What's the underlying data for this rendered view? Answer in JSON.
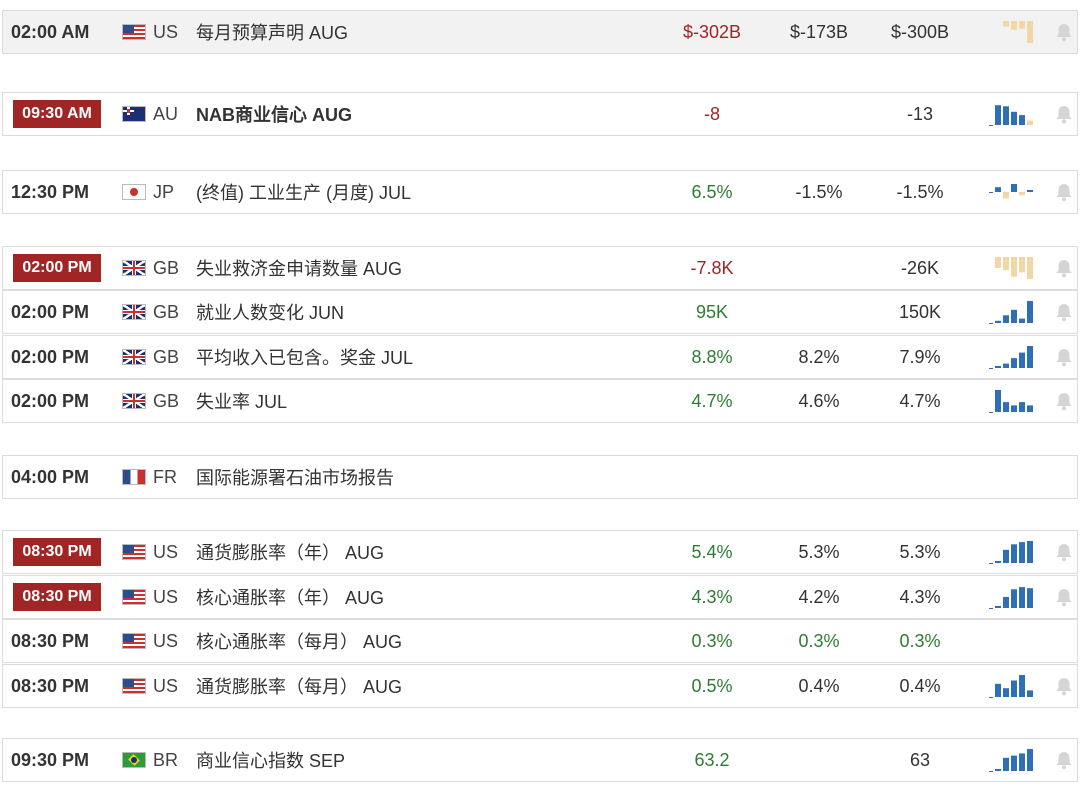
{
  "colors": {
    "highlight_time_bg": "#a12525",
    "negative": "#a12525",
    "positive": "#2e7d32",
    "spark_blue": "#2f6fb5",
    "spark_tan": "#f3d6a6",
    "bell": "#d5d5d5"
  },
  "events": [
    {
      "time": "02:00 AM",
      "highlight": false,
      "shaded": true,
      "flag": "us",
      "country": "US",
      "event": "每月预算声明 AUG",
      "bold": false,
      "actual": "$-302B",
      "actual_tone": "neg",
      "forecast": "$-173B",
      "previous": "$-300B",
      "previous_tone": "",
      "spark": "tan",
      "spark_values": [
        0.25,
        0.4,
        0.35,
        1.0
      ],
      "bell": true
    },
    {
      "time": "09:30 AM",
      "highlight": true,
      "shaded": false,
      "flag": "au",
      "country": "AU",
      "event": "NAB商业信心 AUG",
      "bold": true,
      "actual": "-8",
      "actual_tone": "neg",
      "forecast": "",
      "previous": "-13",
      "previous_tone": "",
      "spark": "blue",
      "spark_values": [
        0.9,
        0.85,
        0.6,
        0.45,
        0.2
      ],
      "bell": true
    },
    {
      "time": "12:30 PM",
      "highlight": false,
      "shaded": false,
      "flag": "jp",
      "country": "JP",
      "event": "(终值) 工业生产 (月度) JUL",
      "bold": false,
      "actual": "6.5%",
      "actual_tone": "pos",
      "forecast": "-1.5%",
      "previous": "-1.5%",
      "previous_tone": "",
      "spark": "mixed",
      "spark_values": [
        0.3,
        -0.4,
        0.5,
        -0.2,
        0.1
      ],
      "bell": true
    },
    {
      "time": "02:00 PM",
      "highlight": true,
      "shaded": false,
      "flag": "gb",
      "country": "GB",
      "event": "失业救济金申请数量 AUG",
      "bold": false,
      "actual": "-7.8K",
      "actual_tone": "neg",
      "forecast": "",
      "previous": "-26K",
      "previous_tone": "",
      "spark": "tan",
      "spark_values": [
        0.5,
        0.6,
        0.9,
        0.7,
        1.0
      ],
      "bell": true
    },
    {
      "time": "02:00 PM",
      "highlight": false,
      "shaded": false,
      "flag": "gb",
      "country": "GB",
      "event": "就业人数变化 JUN",
      "bold": false,
      "actual": "95K",
      "actual_tone": "pos",
      "forecast": "",
      "previous": "150K",
      "previous_tone": "",
      "spark": "blue",
      "spark_values": [
        0.1,
        0.35,
        0.6,
        0.2,
        1.0
      ],
      "bell": true
    },
    {
      "time": "02:00 PM",
      "highlight": false,
      "shaded": false,
      "flag": "gb",
      "country": "GB",
      "event": "平均收入已包含。奖金 JUL",
      "bold": false,
      "actual": "8.8%",
      "actual_tone": "pos",
      "forecast": "8.2%",
      "previous": "7.9%",
      "previous_tone": "",
      "spark": "blue",
      "spark_values": [
        0.05,
        0.2,
        0.45,
        0.7,
        1.0
      ],
      "bell": true
    },
    {
      "time": "02:00 PM",
      "highlight": false,
      "shaded": false,
      "flag": "gb",
      "country": "GB",
      "event": "失业率 JUL",
      "bold": false,
      "actual": "4.7%",
      "actual_tone": "pos",
      "forecast": "4.6%",
      "previous": "4.7%",
      "previous_tone": "",
      "spark": "blue",
      "spark_values": [
        1.0,
        0.45,
        0.3,
        0.45,
        0.3
      ],
      "bell": true
    },
    {
      "time": "04:00 PM",
      "highlight": false,
      "shaded": false,
      "flag": "fr",
      "country": "FR",
      "event": "国际能源署石油市场报告",
      "bold": false,
      "actual": "",
      "actual_tone": "",
      "forecast": "",
      "previous": "",
      "previous_tone": "",
      "spark": "none",
      "spark_values": [],
      "bell": false
    },
    {
      "time": "08:30 PM",
      "highlight": true,
      "shaded": false,
      "flag": "us",
      "country": "US",
      "event": "通货膨胀率（年） AUG",
      "bold": false,
      "actual": "5.4%",
      "actual_tone": "pos",
      "forecast": "5.3%",
      "previous": "5.3%",
      "previous_tone": "",
      "spark": "blue",
      "spark_values": [
        0.08,
        0.6,
        0.85,
        0.95,
        1.0
      ],
      "bell": true
    },
    {
      "time": "08:30 PM",
      "highlight": true,
      "shaded": false,
      "flag": "us",
      "country": "US",
      "event": "核心通胀率（年） AUG",
      "bold": false,
      "actual": "4.3%",
      "actual_tone": "pos",
      "forecast": "4.2%",
      "previous": "4.3%",
      "previous_tone": "",
      "spark": "blue",
      "spark_values": [
        0.08,
        0.5,
        0.85,
        0.95,
        0.9
      ],
      "bell": true
    },
    {
      "time": "08:30 PM",
      "highlight": false,
      "shaded": false,
      "flag": "us",
      "country": "US",
      "event": "核心通胀率（每月） AUG",
      "bold": false,
      "actual": "0.3%",
      "actual_tone": "pos",
      "forecast": "0.3%",
      "forecast_tone": "pos",
      "previous": "0.3%",
      "previous_tone": "pos",
      "spark": "none",
      "spark_values": [],
      "bell": false
    },
    {
      "time": "08:30 PM",
      "highlight": false,
      "shaded": false,
      "flag": "us",
      "country": "US",
      "event": "通货膨胀率（每月） AUG",
      "bold": false,
      "actual": "0.5%",
      "actual_tone": "pos",
      "forecast": "0.4%",
      "previous": "0.4%",
      "previous_tone": "",
      "spark": "blue",
      "spark_values": [
        0.6,
        0.4,
        0.75,
        1.0,
        0.3
      ],
      "bell": true
    },
    {
      "time": "09:30 PM",
      "highlight": false,
      "shaded": false,
      "flag": "br",
      "country": "BR",
      "event": "商业信心指数 SEP",
      "bold": false,
      "actual": "63.2",
      "actual_tone": "pos",
      "forecast": "",
      "previous": "63",
      "previous_tone": "",
      "spark": "blue",
      "spark_values": [
        0.05,
        0.6,
        0.7,
        0.8,
        1.0
      ],
      "bell": true
    }
  ]
}
